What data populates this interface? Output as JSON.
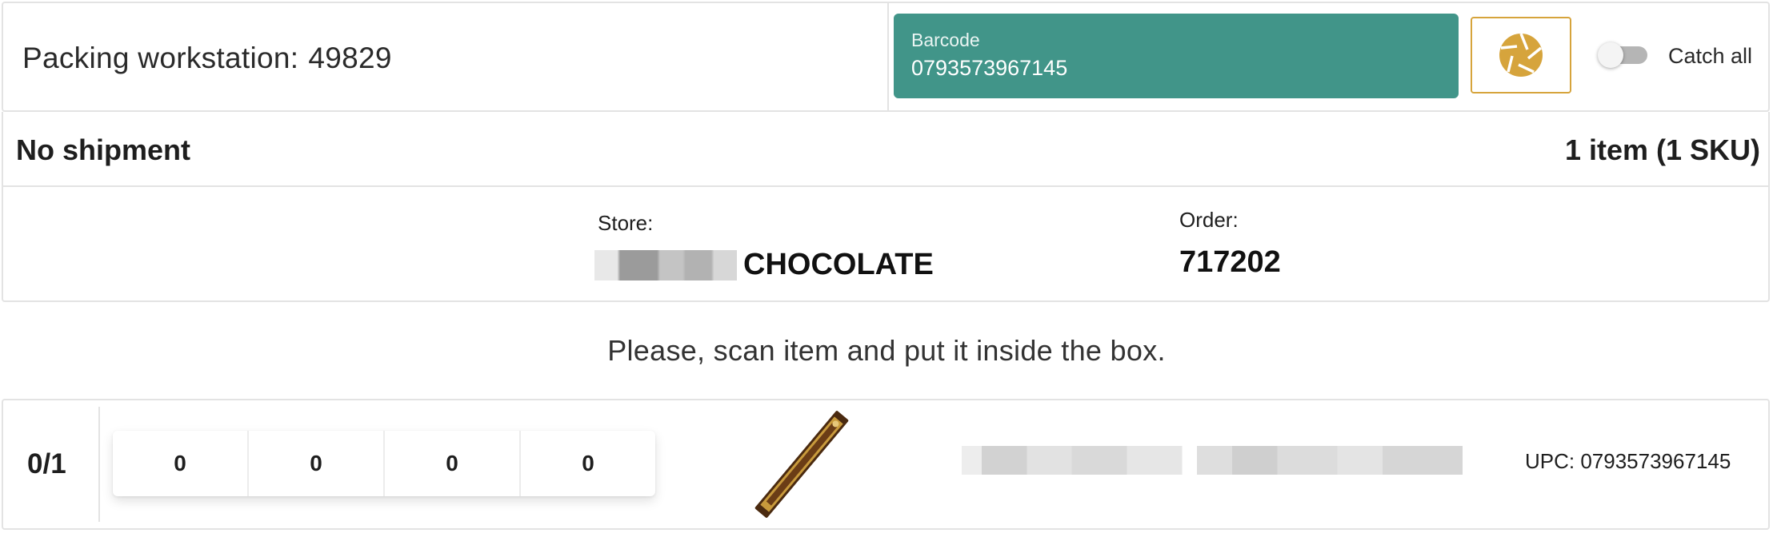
{
  "header": {
    "title_label": "Packing workstation:",
    "workstation_id": "49829",
    "barcode_label": "Barcode",
    "barcode_value": "0793573967145",
    "shutter_icon": "camera-shutter-icon",
    "catch_all_label": "Catch all",
    "catch_all_on": false
  },
  "shipment": {
    "status": "No shipment",
    "summary": "1 item (1 SKU)"
  },
  "info": {
    "store_label": "Store:",
    "store_name": "CHOCOLATE",
    "order_label": "Order:",
    "order_number": "717202"
  },
  "instruction": "Please, scan item and put it inside the box.",
  "item": {
    "progress": "0/1",
    "counters": [
      "0",
      "0",
      "0",
      "0"
    ],
    "image_icon": "chocolate-bar-image",
    "upc": "UPC: 0793573967145"
  },
  "colors": {
    "barcode_bg": "#419589",
    "accent": "#d6a43c",
    "border": "#e3e3e3"
  }
}
